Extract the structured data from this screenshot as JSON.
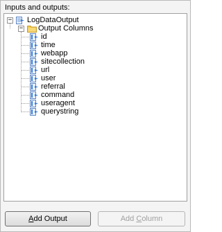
{
  "section_label": "Inputs and outputs:",
  "tree": {
    "output_name": "LogDataOutput",
    "columns_folder": "Output Columns",
    "columns": [
      "id",
      "time",
      "webapp",
      "sitecollection",
      "url",
      "user",
      "referral",
      "command",
      "useragent",
      "querystring"
    ]
  },
  "buttons": {
    "add_output": {
      "prefix": "",
      "mnemonic": "A",
      "rest": "dd Output"
    },
    "add_column": {
      "prefix": "Add ",
      "mnemonic": "C",
      "rest": "olumn"
    }
  },
  "colors": {
    "selected_blue": "#3b7bd4",
    "folder_yellow": "#f2c94c",
    "disabled_text": "#a0a0a0"
  }
}
